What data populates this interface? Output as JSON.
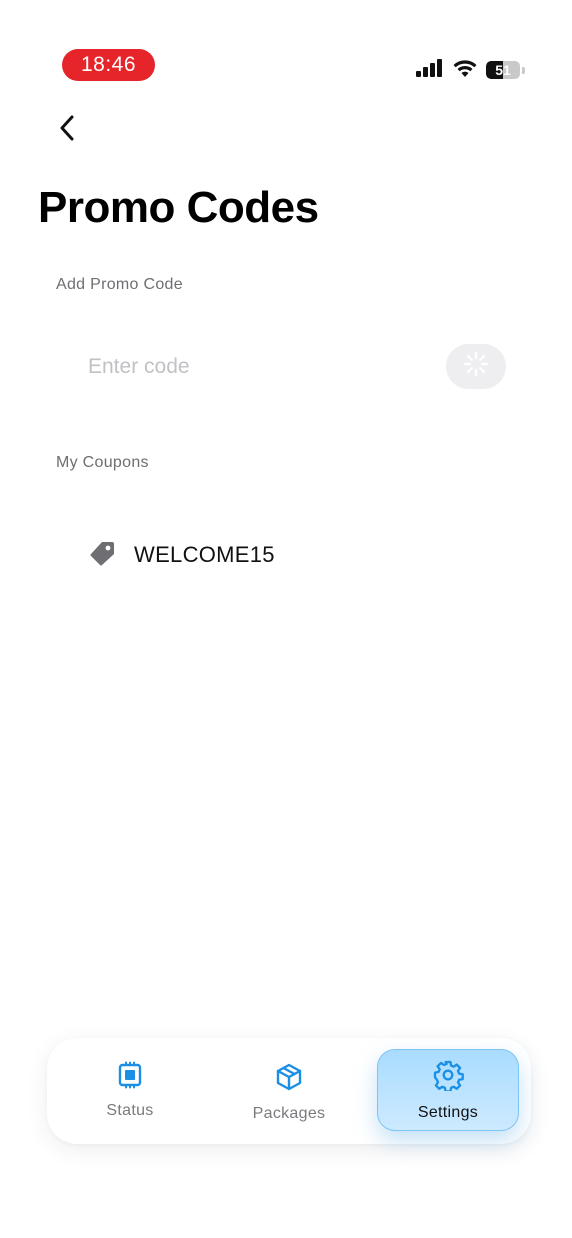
{
  "status_bar": {
    "time": "18:46",
    "battery_level": "51"
  },
  "header": {
    "title": "Promo Codes"
  },
  "add_promo": {
    "label": "Add Promo Code",
    "placeholder": "Enter code",
    "value": ""
  },
  "coupons": {
    "label": "My Coupons",
    "items": [
      {
        "code": "WELCOME15",
        "icon": "tag-icon"
      }
    ]
  },
  "tabbar": {
    "tabs": [
      {
        "label": "Status",
        "icon": "chip-icon",
        "active": false
      },
      {
        "label": "Packages",
        "icon": "box-icon",
        "active": false
      },
      {
        "label": "Settings",
        "icon": "gear-icon",
        "active": true
      }
    ]
  },
  "colors": {
    "time_pill": "#e5252a",
    "accent_blue": "#1a8fe3",
    "active_tab_bg": "#b9e2ff"
  }
}
